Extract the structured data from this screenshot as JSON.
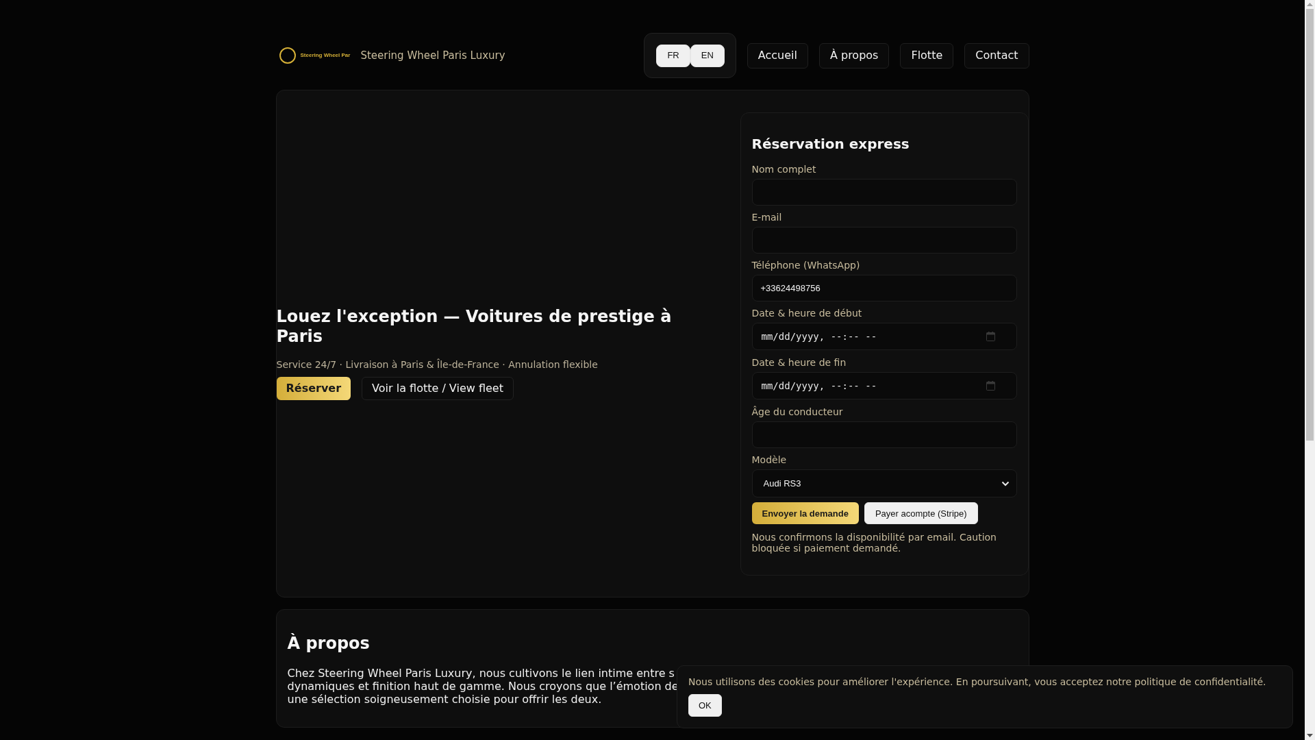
{
  "header": {
    "logo_text": "Steering Wheel Par",
    "brand": "Steering Wheel Paris Luxury",
    "languages": [
      "FR",
      "EN"
    ],
    "nav": [
      "Accueil",
      "À propos",
      "Flotte",
      "Contact"
    ]
  },
  "hero": {
    "title": "Louez l'exception — Voitures de prestige à Paris",
    "subtitle": "Service 24/7 · Livraison à Paris & Île-de-France · Annulation flexible",
    "buttons": [
      {
        "label": "Réserver",
        "kind": "primary"
      },
      {
        "label": "Voir la flotte / View fleet",
        "kind": "outline"
      }
    ]
  },
  "booking_form": {
    "title": "Réservation express",
    "fields": [
      {
        "label": "Nom complet",
        "kind": "text"
      },
      {
        "label": "E-mail",
        "kind": "text"
      },
      {
        "label": "Téléphone (WhatsApp)",
        "kind": "text",
        "value": "+33624498756"
      },
      {
        "label": "Date & heure de début",
        "kind": "datetime",
        "placeholder": "mm/dd/yyyy, --:-- --"
      },
      {
        "label": "Date & heure de fin",
        "kind": "datetime",
        "placeholder": "mm/dd/yyyy, --:-- --"
      },
      {
        "label": "Âge du conducteur",
        "kind": "text"
      },
      {
        "label": "Modèle",
        "kind": "select",
        "value": "Audi RS3"
      }
    ],
    "buttons": [
      {
        "label": "Envoyer la demande",
        "kind": "primary"
      },
      {
        "label": "Payer acompte (Stripe)",
        "kind": "light"
      }
    ],
    "note": "Nous confirmons la disponibilité par email. Caution bloquée si paiement demandé."
  },
  "about": {
    "title": "À propos",
    "lines": [
      "Chez Steering Wheel Paris Luxury, nous cultivons le lien intime entre s",
      "dynamiques et finition haut de gamme. Nous croyons que l’émotion de",
      "une sélection soigneusement choisie pour offrir les deux."
    ]
  },
  "cookie_banner": {
    "text": "Nous utilisons des cookies pour améliorer l'expérience. En poursuivant, vous acceptez notre politique de confidentialité.",
    "button": "OK"
  }
}
